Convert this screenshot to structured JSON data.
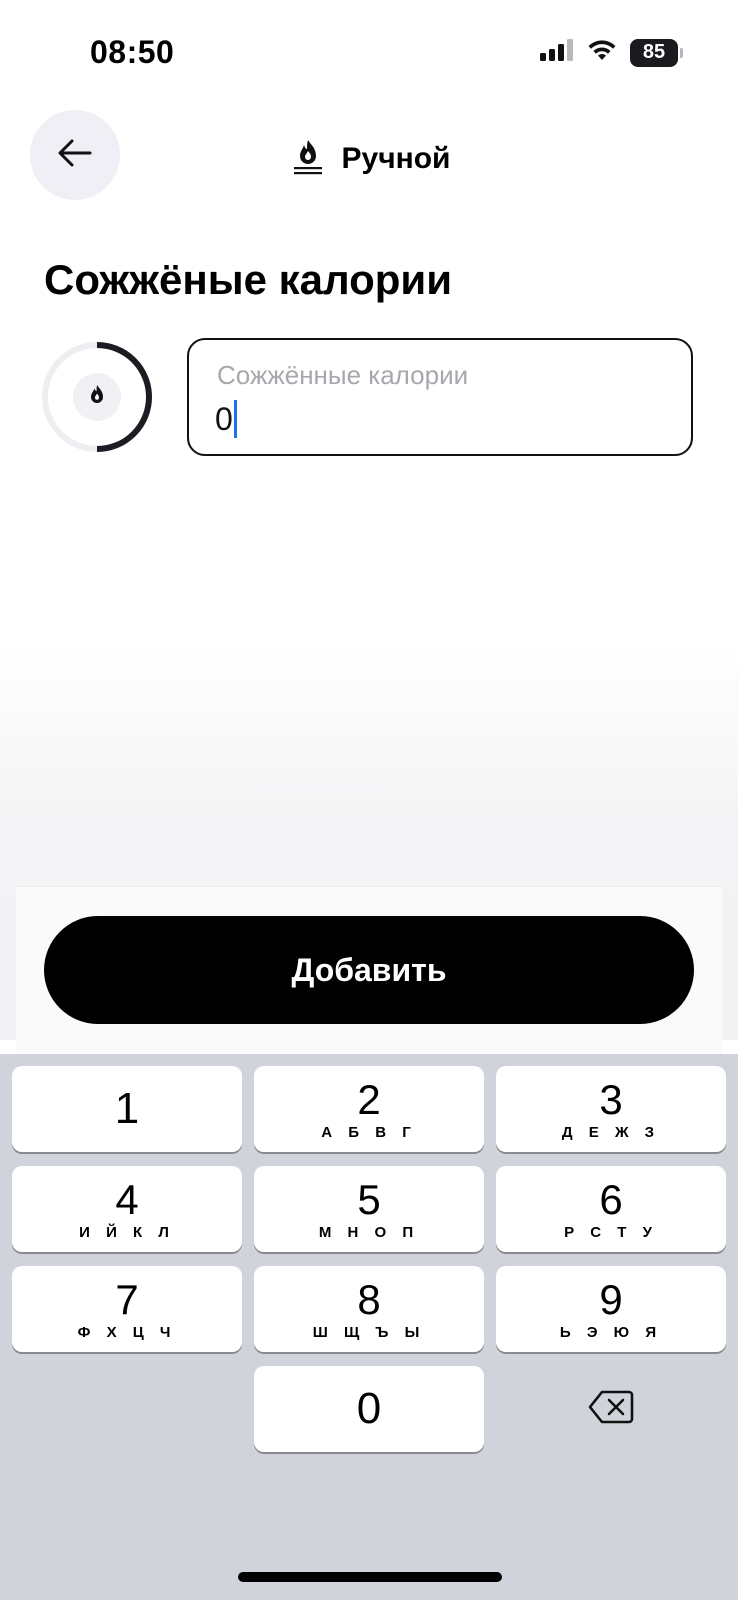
{
  "status_bar": {
    "time": "08:50",
    "battery": "85",
    "icons": [
      "cellular-signal-icon",
      "wifi-icon",
      "battery-icon"
    ]
  },
  "header": {
    "back_icon": "arrow-left-icon",
    "title_icon": "flame-icon",
    "title": "Ручной"
  },
  "page": {
    "title": "Сожжёные калории"
  },
  "progress": {
    "icon": "flame-icon",
    "fraction": 0.5
  },
  "input": {
    "label": "Сожжённые калории",
    "value": "0"
  },
  "actions": {
    "add_label": "Добавить"
  },
  "keyboard": {
    "keys": [
      {
        "digit": "1",
        "letters": ""
      },
      {
        "digit": "2",
        "letters": "А Б В Г"
      },
      {
        "digit": "3",
        "letters": "Д Е Ж З"
      },
      {
        "digit": "4",
        "letters": "И Й К Л"
      },
      {
        "digit": "5",
        "letters": "М Н О П"
      },
      {
        "digit": "6",
        "letters": "Р С Т У"
      },
      {
        "digit": "7",
        "letters": "Ф Х Ц Ч"
      },
      {
        "digit": "8",
        "letters": "Ш Щ Ъ Ы"
      },
      {
        "digit": "9",
        "letters": "Ь Э Ю Я"
      },
      {
        "digit": "0",
        "letters": ""
      }
    ],
    "delete_icon": "backspace-icon"
  },
  "colors": {
    "accent": "#000000",
    "caret": "#1a73e8",
    "back_button_bg": "#efeff5",
    "keyboard_bg": "#d1d3da",
    "placeholder": "#a7a7ad"
  }
}
